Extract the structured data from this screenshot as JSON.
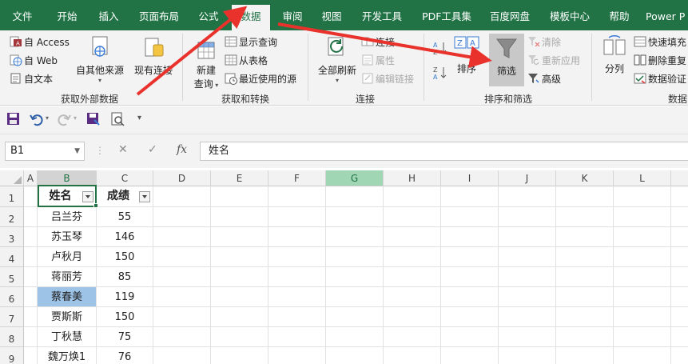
{
  "menu": {
    "tabs": [
      {
        "label": "文件"
      },
      {
        "label": "开始"
      },
      {
        "label": "插入"
      },
      {
        "label": "页面布局"
      },
      {
        "label": "公式"
      },
      {
        "label": "数据"
      },
      {
        "label": "审阅"
      },
      {
        "label": "视图"
      },
      {
        "label": "开发工具"
      },
      {
        "label": "PDF工具集"
      },
      {
        "label": "百度网盘"
      },
      {
        "label": "模板中心"
      },
      {
        "label": "帮助"
      },
      {
        "label": "Power P"
      }
    ],
    "active_index": 5
  },
  "ribbon": {
    "get_external": {
      "access": "自 Access",
      "web": "自 Web",
      "text": "自文本",
      "other_sources": "自其他来源",
      "existing": "现有连接",
      "group_label": "获取外部数据"
    },
    "get_transform": {
      "new_query": "新建",
      "new_query2": "查询",
      "show_queries": "显示查询",
      "from_table": "从表格",
      "recent_sources": "最近使用的源",
      "group_label": "获取和转换"
    },
    "connections": {
      "refresh_all": "全部刷新",
      "connections": "连接",
      "properties": "属性",
      "edit_links": "编辑链接",
      "group_label": "连接"
    },
    "sort_filter": {
      "sort": "排序",
      "filter": "筛选",
      "clear": "清除",
      "reapply": "重新应用",
      "advanced": "高级",
      "group_label": "排序和筛选"
    },
    "data_tools": {
      "split": "分列",
      "flash_fill": "快速填充",
      "remove_dup": "删除重复",
      "validate": "数据验证",
      "group_label": "数据"
    }
  },
  "formula_bar": {
    "name_box": "B1",
    "value": "姓名",
    "fx": "fx",
    "cancel": "✕",
    "enter": "✓"
  },
  "columns": [
    "A",
    "B",
    "C",
    "D",
    "E",
    "F",
    "G",
    "H",
    "I",
    "J",
    "K",
    "L"
  ],
  "rows": [
    "1",
    "2",
    "3",
    "4",
    "5",
    "6",
    "7",
    "8",
    "9"
  ],
  "table": {
    "headers": [
      "姓名",
      "成绩"
    ],
    "rows": [
      [
        "吕兰芬",
        "55"
      ],
      [
        "苏玉琴",
        "146"
      ],
      [
        "卢秋月",
        "150"
      ],
      [
        "蒋丽芳",
        "85"
      ],
      [
        "蔡春美",
        "119"
      ],
      [
        "贾斯斯",
        "150"
      ],
      [
        "丁秋慧",
        "75"
      ],
      [
        "魏万焕1",
        "76"
      ]
    ]
  },
  "colors": {
    "excel_green": "#217346",
    "arrow_red": "#e8322b",
    "highlight_cell": "#9dc3e6",
    "g_column_header": "#a0d6b4"
  }
}
